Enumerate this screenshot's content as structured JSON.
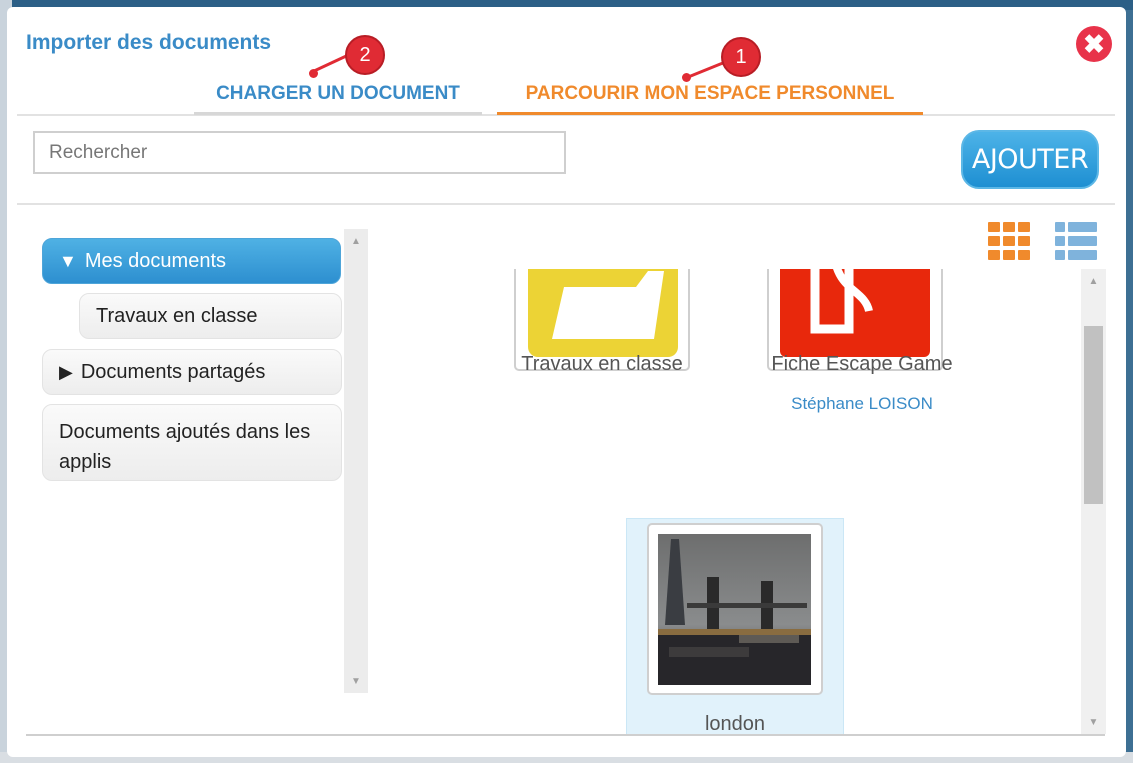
{
  "dialog": {
    "title": "Importer des documents",
    "close_label": "✖"
  },
  "tabs": [
    {
      "label": "CHARGER UN DOCUMENT",
      "active": false
    },
    {
      "label": "PARCOURIR MON ESPACE PERSONNEL",
      "active": true
    }
  ],
  "markers": [
    {
      "label": "2"
    },
    {
      "label": "1"
    }
  ],
  "search": {
    "placeholder": "Rechercher",
    "value": ""
  },
  "toolbar": {
    "add_label": "AJOUTER"
  },
  "tree": {
    "items": [
      {
        "toggle": "▼",
        "label": "Mes documents",
        "active": true
      },
      {
        "toggle": "",
        "label": "Travaux en classe",
        "active": false
      },
      {
        "toggle": "▶",
        "label": "Documents partagés",
        "active": false
      },
      {
        "toggle": "",
        "label": "Documents ajoutés dans les applis",
        "active": false
      }
    ]
  },
  "documents": [
    {
      "name": "Travaux en classe",
      "owner": "",
      "icon": "folder-icon",
      "color": "#ecd335"
    },
    {
      "name": "Fiche Escape Game",
      "owner": "Stéphane LOISON",
      "icon": "document-icon",
      "color": "#e8280c"
    },
    {
      "name": "london",
      "owner": "",
      "icon": "photo-thumbnail",
      "selected": true
    }
  ],
  "colors": {
    "accent_blue": "#3a8bc7",
    "accent_orange": "#f08a2c",
    "close_red": "#e8334a",
    "selected_bg": "#e1f2fb"
  }
}
